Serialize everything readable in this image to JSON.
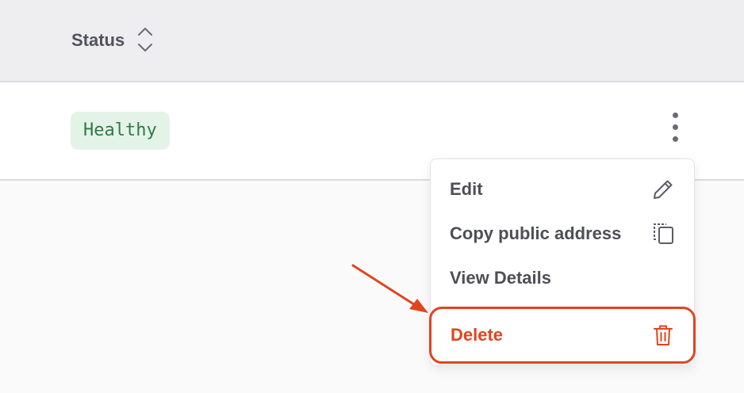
{
  "table": {
    "header": {
      "status_label": "Status",
      "sort_icon": "sort-updown-icon"
    },
    "row": {
      "status_badge": "Healthy",
      "actions_icon": "kebab-menu-icon"
    }
  },
  "menu": {
    "items": [
      {
        "label": "Edit",
        "icon": "pencil-icon"
      },
      {
        "label": "Copy public address",
        "icon": "copy-icon"
      },
      {
        "label": "View Details",
        "icon": ""
      },
      {
        "label": "Delete",
        "icon": "trash-icon"
      }
    ]
  },
  "colors": {
    "header_bg": "#eeeef1",
    "badge_bg": "#e4f3e8",
    "badge_text": "#2f7a45",
    "danger": "#e1441f",
    "annotation": "#e1441f"
  }
}
